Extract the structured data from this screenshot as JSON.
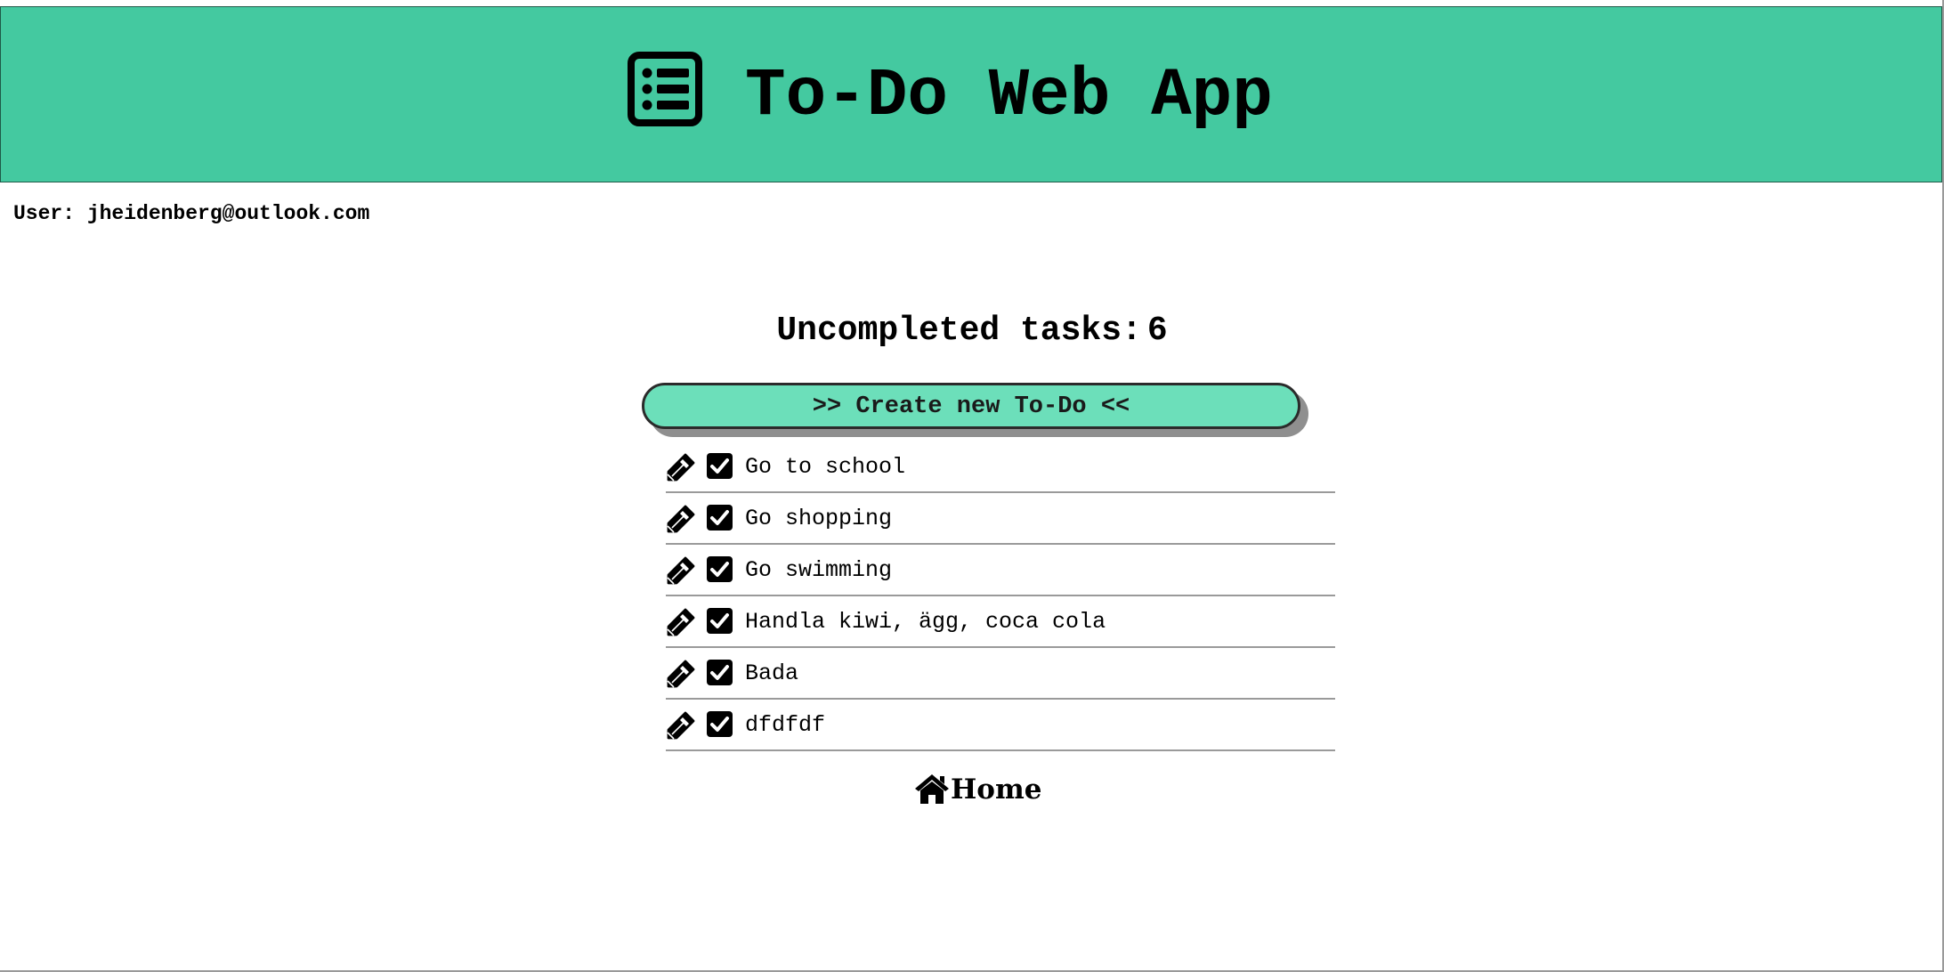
{
  "header": {
    "title": "To-Do Web App",
    "icon": "list-icon",
    "bg_color": "#44c9a0"
  },
  "user": {
    "line": "User: jheidenberg@outlook.com"
  },
  "summary": {
    "label": "Uncompleted tasks:",
    "count": "6"
  },
  "create_button": {
    "label": ">> Create new To-Do <<",
    "bg_color": "#6cdfba"
  },
  "todos": [
    {
      "text": "Go to school",
      "checked": true
    },
    {
      "text": "Go shopping",
      "checked": true
    },
    {
      "text": "Go swimming",
      "checked": true
    },
    {
      "text": "Handla kiwi, ägg, coca cola",
      "checked": true
    },
    {
      "text": "Bada",
      "checked": true
    },
    {
      "text": "dfdfdf",
      "checked": true
    }
  ],
  "icons": {
    "edit": "pencil-icon",
    "check": "checkbox-checked-icon",
    "home": "home-icon"
  },
  "nav": {
    "home_label": "Home"
  }
}
